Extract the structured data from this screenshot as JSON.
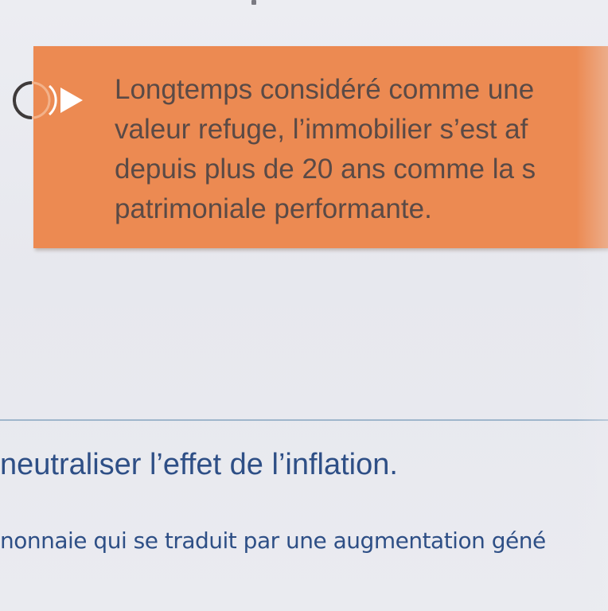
{
  "callout": {
    "lines": [
      "Longtemps considéré comme une",
      "valeur refuge, l’immobilier s’est af",
      "depuis plus de 20 ans comme la s",
      "patrimoniale performante."
    ],
    "background_color": "#ec8a52",
    "text_color": "#5a4a46",
    "icon": "circle-arrow-icon"
  },
  "section": {
    "heading": "neutraliser l’effet de l’inflation.",
    "body_line": "nonnaie qui se traduit par une augmentation géné",
    "text_color": "#2e4f86",
    "divider_color": "#9fb6cc"
  }
}
